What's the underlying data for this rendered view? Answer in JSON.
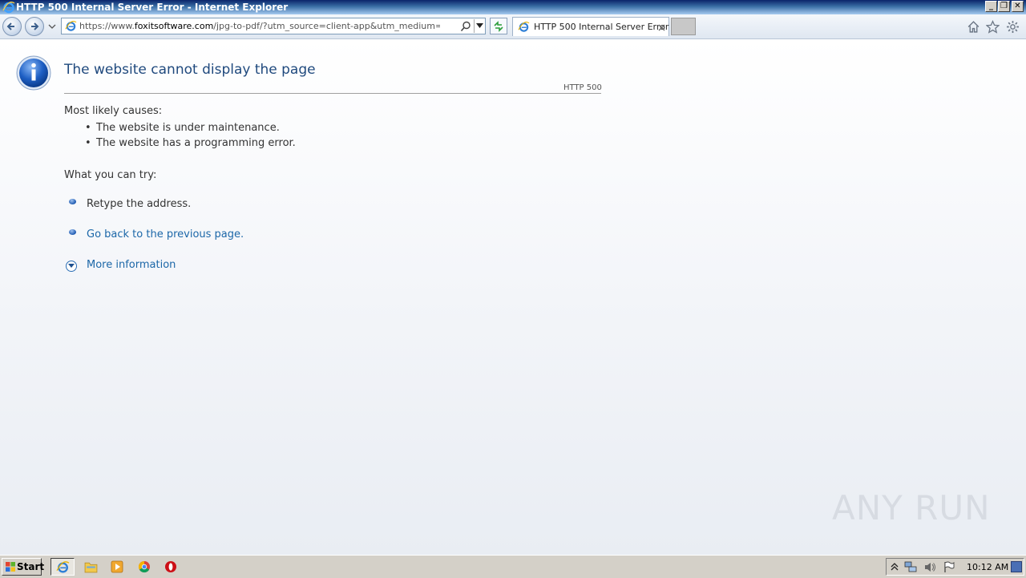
{
  "window": {
    "title": "HTTP 500 Internal Server Error - Internet Explorer"
  },
  "navbar": {
    "url_prefix": "https://www.",
    "url_domain": "foxitsoftware.com",
    "url_rest": "/jpg-to-pdf/?utm_source=client-app&utm_medium=ReaderAd&utm",
    "tab_title": "HTTP 500 Internal Server Error"
  },
  "page": {
    "title": "The website cannot display the page",
    "code": "HTTP 500",
    "causes_heading": "Most likely causes:",
    "causes": [
      "The website is under maintenance.",
      "The website has a programming error."
    ],
    "try_heading": "What you can try:",
    "try_items": [
      "Retype the address.",
      "Go back to the previous page."
    ],
    "more_info": "More information"
  },
  "watermark": "ANY RUN",
  "taskbar": {
    "start_label": "Start",
    "clock": "10:12 AM"
  },
  "colors": {
    "title_blue": "#1f497d",
    "link_blue": "#1c67a8"
  }
}
